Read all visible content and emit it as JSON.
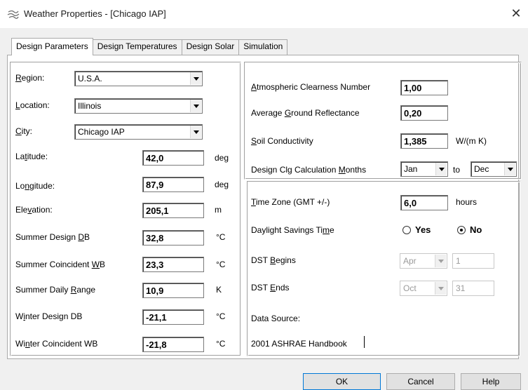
{
  "window": {
    "title": "Weather Properties - [Chicago IAP]",
    "close_glyph": "✕",
    "app_icon": "weather-wind-icon"
  },
  "tabs": [
    {
      "label": "Design Parameters",
      "active": true
    },
    {
      "label": "Design Temperatures",
      "active": false
    },
    {
      "label": "Design Solar",
      "active": false
    },
    {
      "label": "Simulation",
      "active": false
    }
  ],
  "left": {
    "region": {
      "label_pre": "",
      "label_u": "R",
      "label_post": "egion:",
      "value": "U.S.A."
    },
    "location": {
      "label_pre": "",
      "label_u": "L",
      "label_post": "ocation:",
      "value": "Illinois"
    },
    "city": {
      "label_pre": "",
      "label_u": "C",
      "label_post": "ity:",
      "value": "Chicago IAP"
    },
    "rows": [
      {
        "label_pre": "La",
        "label_u": "t",
        "label_post": "itude:",
        "value": "42,0",
        "unit": "deg"
      },
      {
        "label_pre": "Lo",
        "label_u": "n",
        "label_post": "gitude:",
        "value": "87,9",
        "unit": "deg"
      },
      {
        "label_pre": "Ele",
        "label_u": "v",
        "label_post": "ation:",
        "value": "205,1",
        "unit": "m"
      },
      {
        "label_pre": "Summer Design ",
        "label_u": "D",
        "label_post": "B",
        "value": "32,8",
        "unit": "°C"
      },
      {
        "label_pre": "Summer Coincident ",
        "label_u": "W",
        "label_post": "B",
        "value": "23,3",
        "unit": "°C"
      },
      {
        "label_pre": "Summer Daily ",
        "label_u": "R",
        "label_post": "ange",
        "value": "10,9",
        "unit": "K"
      },
      {
        "label_pre": "W",
        "label_u": "i",
        "label_post": "nter Design DB",
        "value": "-21,1",
        "unit": "°C"
      },
      {
        "label_pre": "Wi",
        "label_u": "n",
        "label_post": "ter Coincident WB",
        "value": "-21,8",
        "unit": "°C"
      }
    ]
  },
  "right_top": {
    "clearness": {
      "label_pre": "",
      "label_u": "A",
      "label_post": "tmospheric Clearness Number",
      "value": "1,00"
    },
    "reflectance": {
      "label_pre": "Average ",
      "label_u": "G",
      "label_post": "round Reflectance",
      "value": "0,20"
    },
    "soil": {
      "label_pre": "",
      "label_u": "S",
      "label_post": "oil Conductivity",
      "value": "1,385",
      "unit": "W/(m K)"
    },
    "months": {
      "label_pre": "Design Clg Calculation ",
      "label_u": "M",
      "label_post": "onths",
      "from": "Jan",
      "to_label": "to",
      "to": "Dec"
    }
  },
  "right_bottom": {
    "timezone": {
      "label_pre": "",
      "label_u": "T",
      "label_post": "ime Zone (GMT +/-)",
      "value": "6,0",
      "unit": "hours"
    },
    "dst": {
      "label_pre": "Daylight Savings Ti",
      "label_u": "m",
      "label_post": "e",
      "yes": "Yes",
      "no": "No",
      "selected": "No"
    },
    "dst_begins": {
      "label_pre": "DST ",
      "label_u": "B",
      "label_post": "egins",
      "month": "Apr",
      "day": "1"
    },
    "dst_ends": {
      "label_pre": "DST ",
      "label_u": "E",
      "label_post": "nds",
      "month": "Oct",
      "day": "31"
    },
    "data_source_label": "Data Source:",
    "data_source_value": "2001 ASHRAE Handbook"
  },
  "buttons": {
    "ok": "OK",
    "cancel": "Cancel",
    "help": "Help"
  }
}
